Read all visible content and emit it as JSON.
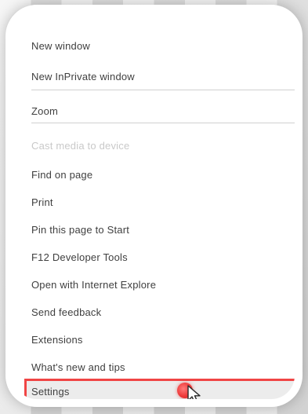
{
  "menu": {
    "items": [
      {
        "label": "New window"
      },
      {
        "label": "New InPrivate window"
      },
      {
        "label": "Zoom"
      },
      {
        "label": "Cast media to device",
        "disabled": true
      },
      {
        "label": "Find on page"
      },
      {
        "label": "Print"
      },
      {
        "label": "Pin this page to Start"
      },
      {
        "label": "F12 Developer Tools"
      },
      {
        "label": "Open with Internet Explore"
      },
      {
        "label": "Send feedback"
      },
      {
        "label": "Extensions"
      },
      {
        "label": "What's new and tips"
      },
      {
        "label": "Settings",
        "highlighted": true
      }
    ]
  },
  "colors": {
    "highlight_border": "#f04545",
    "text": "#3f3f3f",
    "disabled_text": "#c9c9c9",
    "divider": "#d0d0d0"
  },
  "icons": {
    "cursor": "mouse-pointer-icon",
    "click_indicator": "click-dot-icon"
  }
}
